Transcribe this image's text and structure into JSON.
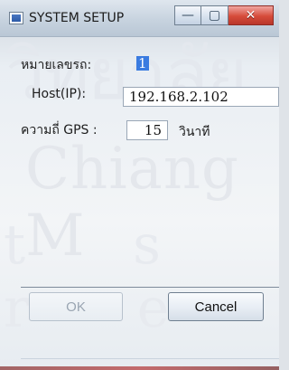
{
  "window": {
    "title": "SYSTEM SETUP",
    "icons": {
      "app": "window-app-icon",
      "minimize": "minimize-icon",
      "maximize": "maximize-icon",
      "close": "close-icon"
    },
    "close_color": "#d64b3a"
  },
  "form": {
    "vehicle_label": "หมายเลขรถ:",
    "vehicle_value": "1",
    "host_label": "Host(IP):",
    "host_value": "192.168.2.102",
    "gps_label": "ความถี่ GPS :",
    "gps_value": "15",
    "gps_unit": "วินาที"
  },
  "buttons": {
    "ok": "OK",
    "cancel": "Cancel"
  },
  "watermark": {
    "line1": "วิทยาลัย",
    "line2": "Chiang M",
    "line3": "t s r e"
  }
}
